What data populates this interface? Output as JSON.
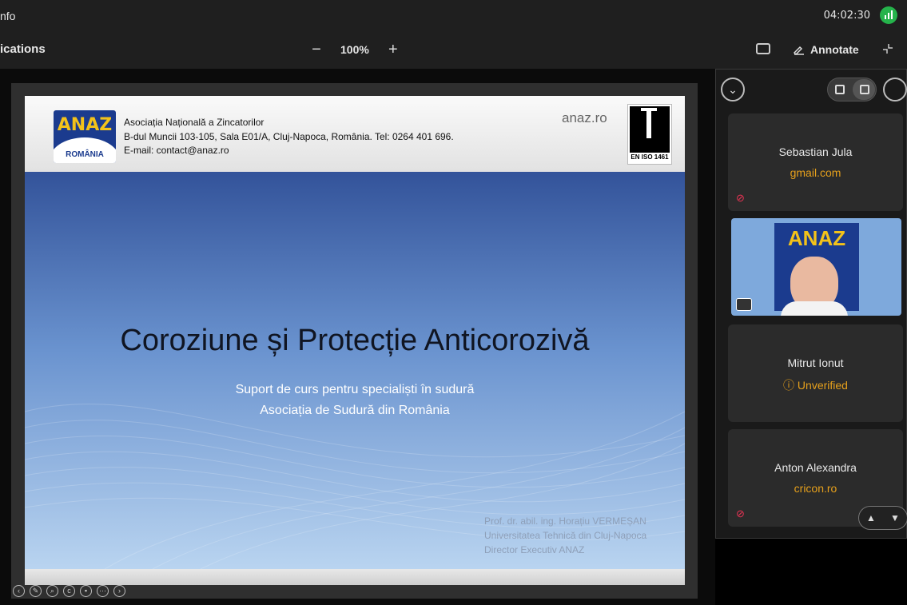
{
  "window": {
    "title": "nfo",
    "timer": "04:02:30"
  },
  "toolbar": {
    "left_label": "ications",
    "zoom_out": "−",
    "zoom_value": "100%",
    "zoom_in": "+",
    "annotate_label": "Annotate"
  },
  "slide": {
    "header_line1": "Asociația Națională a Zincatorilor",
    "header_line2": "B-dul Muncii 103-105, Sala E01/A, Cluj-Napoca, România. Tel: 0264 401 696.",
    "header_line3": "E-mail: contact@anaz.ro",
    "site": "anaz.ro",
    "logo_top": "ANAZ",
    "logo_bottom": "ROMÂNIA",
    "iso_label": "EN ISO 1461",
    "title": "Coroziune și Protecție Anticorozivă",
    "subtitle1": "Suport de curs pentru specialiști în sudură",
    "subtitle2": "Asociația de Sudură din România",
    "author1": "Prof. dr. abil. ing. Horațiu VERMEȘAN",
    "author2": "Universitatea Tehnică din Cluj-Napoca",
    "author3": "Director Executiv ANAZ"
  },
  "participants": [
    {
      "name": "Sebastian Jula",
      "sub": "gmail.com",
      "muted": true
    },
    {
      "name": "Mitrut Ionut",
      "sub": "Unverified",
      "muted": false
    },
    {
      "name": "Anton Alexandra",
      "sub": "cricon.ro",
      "muted": true
    }
  ],
  "video_logo": "ANAZ",
  "icons": {
    "signal": "signal-icon",
    "share": "share-screen-icon",
    "annotate": "pen-icon",
    "exit_full": "exit-fullscreen-icon",
    "collapse": "chevron-down-icon",
    "mute": "mic-off-icon",
    "warning": "info-circle-icon"
  },
  "colors": {
    "accent_orange": "#e6a01c",
    "signal_green": "#25b34b",
    "slide_blue": "#33539a"
  }
}
